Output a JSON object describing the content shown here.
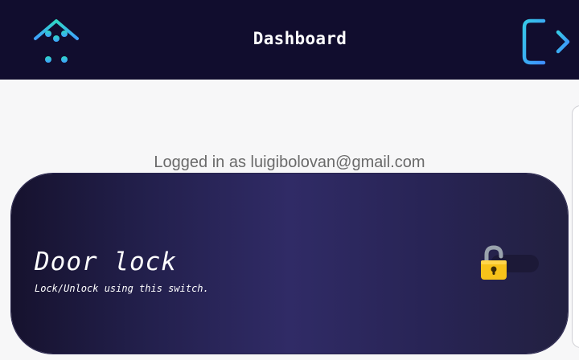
{
  "header": {
    "title": "Dashboard",
    "home_icon": "smart-home-icon",
    "logout_icon": "logout-icon"
  },
  "session": {
    "logged_in_text": "Logged in as luigibolovan@gmail.com"
  },
  "door_lock": {
    "title": "Door lock",
    "subtitle": "Lock/Unlock using this switch.",
    "switch_state": "unlocked",
    "icon": "padlock-icon"
  },
  "colors": {
    "header_bg": "#110d2e",
    "page_bg": "#f7f7f8",
    "icon_teal": "#2fd8c4",
    "icon_blue": "#3fa0ff",
    "lock_yellow": "#f7c21a"
  }
}
